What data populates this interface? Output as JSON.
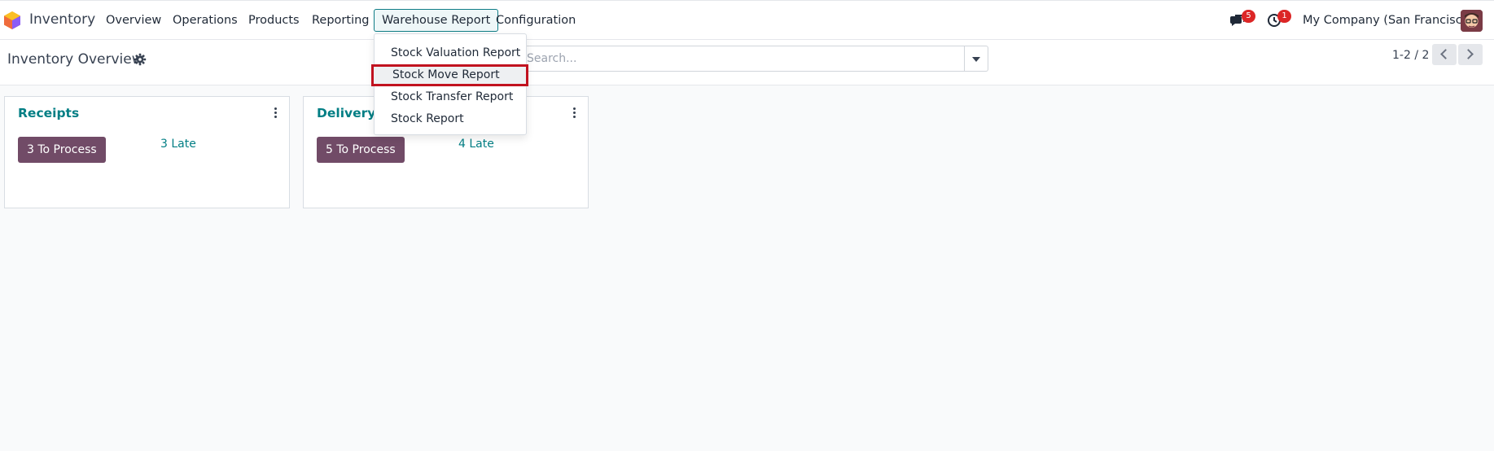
{
  "navbar": {
    "app_name": "Inventory",
    "menu": [
      {
        "label": "Overview"
      },
      {
        "label": "Operations"
      },
      {
        "label": "Products"
      },
      {
        "label": "Reporting"
      },
      {
        "label": "Warehouse Report",
        "active": true
      },
      {
        "label": "Configuration"
      }
    ],
    "messages_count": "5",
    "activities_count": "1",
    "company": "My Company (San Francisco)"
  },
  "dropdown": {
    "items": [
      {
        "label": "Stock Valuation Report"
      },
      {
        "label": "Stock Move Report",
        "highlighted": true
      },
      {
        "label": "Stock Transfer Report"
      },
      {
        "label": "Stock Report"
      }
    ]
  },
  "control_panel": {
    "title": "Inventory Overview",
    "search_placeholder": "Search...",
    "pager": "1-2 / 2"
  },
  "cards": [
    {
      "title": "Receipts",
      "process_label": "3 To Process",
      "late_label": "3 Late"
    },
    {
      "title": "Delivery Orders",
      "process_label": "5 To Process",
      "late_label": "4 Late"
    }
  ],
  "colors": {
    "accent": "#017e84",
    "primary_button": "#714b67",
    "badge": "#dc2626",
    "highlight_border": "#c1121f"
  }
}
